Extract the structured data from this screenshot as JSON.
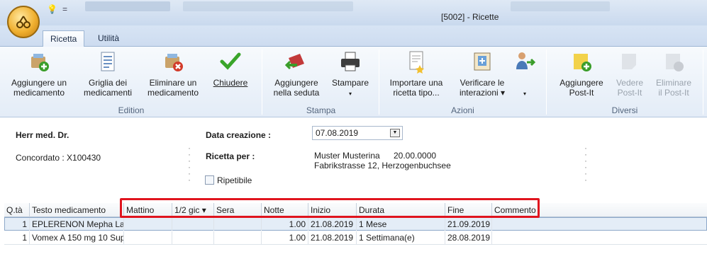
{
  "window": {
    "title": "[5002] - Ricette",
    "qat_icon": "lightbulb-icon",
    "qat_dropdown": "="
  },
  "tabs": [
    {
      "label": "Ricetta",
      "active": true
    },
    {
      "label": "Utilità",
      "active": false
    }
  ],
  "ribbon": {
    "groups": [
      {
        "label": "Edition"
      },
      {
        "label": "Stampa"
      },
      {
        "label": "Azioni"
      },
      {
        "label": "Diversi"
      }
    ],
    "buttons": {
      "add_med": {
        "line1": "Aggiungere un",
        "line2": "medicamento",
        "icon": "add-medication-icon"
      },
      "grid_med": {
        "line1": "Griglia dei",
        "line2": "medicamenti",
        "icon": "grid-icon"
      },
      "del_med": {
        "line1": "Eliminare un",
        "line2": "medicamento",
        "icon": "delete-medication-icon"
      },
      "close": {
        "line1": "Chiudere",
        "line2": "",
        "icon": "checkmark-icon"
      },
      "add_session": {
        "line1": "Aggiungere",
        "line2": "nella seduta",
        "icon": "add-to-session-icon"
      },
      "print": {
        "line1": "Stampare",
        "line2": "▾",
        "icon": "printer-icon"
      },
      "import": {
        "line1": "Importare una",
        "line2": "ricetta tipo...",
        "icon": "import-template-icon"
      },
      "check": {
        "line1": "Verificare le",
        "line2": "interazioni ▾",
        "icon": "interactions-icon"
      },
      "more": {
        "line1": "",
        "line2": "▾",
        "icon": "user-arrow-icon"
      },
      "add_postit": {
        "line1": "Aggiungere",
        "line2": "Post-It",
        "icon": "postit-add-icon"
      },
      "view_postit": {
        "line1": "Vedere",
        "line2": "Post-It",
        "icon": "postit-view-icon"
      },
      "del_postit": {
        "line1": "Eliminare",
        "line2": "il Post-It",
        "icon": "postit-delete-icon"
      }
    }
  },
  "info": {
    "doctor": "Herr med. Dr.",
    "agreement": "Concordato : X100430",
    "date_label": "Data creazione :",
    "date_value": "07.08.2019",
    "recipe_for_label": "Ricetta per :",
    "patient_name": "Muster Musterina",
    "patient_dob": "20.00.0000",
    "patient_address": "Fabrikstrasse 12, Herzogenbuchsee",
    "repeatable_label": "Ripetibile",
    "repeatable_checked": false
  },
  "grid": {
    "columns": [
      "Q.tà",
      "Testo medicamento",
      "Mattino",
      "1/2 gic ▾",
      "Sera",
      "Notte",
      "Inizio",
      "Durata",
      "Fine",
      "Commento"
    ],
    "rows": [
      {
        "qty": "1",
        "text": "EPLERENON Mepha Lac",
        "mattino": "",
        "mezzo": "",
        "sera": "",
        "notte": "1.00",
        "inizio": "21.08.2019",
        "durata": "1 Mese",
        "fine": "21.09.2019",
        "commento": "",
        "selected": true
      },
      {
        "qty": "1",
        "text": "Vomex A 150 mg 10 Sup",
        "mattino": "",
        "mezzo": "",
        "sera": "",
        "notte": "1.00",
        "inizio": "21.08.2019",
        "durata": "1 Settimana(e)",
        "fine": "28.08.2019",
        "commento": "",
        "selected": false
      }
    ]
  },
  "colors": {
    "highlight_box": "#e0141e",
    "ribbon_bg": "#e3ecf7",
    "selected_row": "#e4edf7"
  }
}
